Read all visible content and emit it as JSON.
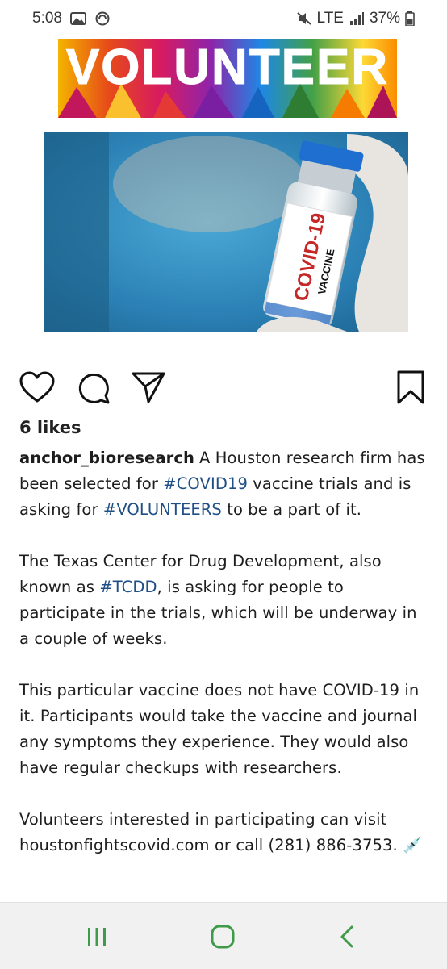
{
  "status_bar": {
    "time": "5:08",
    "network": "LTE",
    "battery": "37%",
    "icons": [
      "gallery-icon",
      "sync-icon",
      "mute-icon",
      "signal-icon",
      "battery-icon"
    ]
  },
  "post": {
    "banner_word": "VOLUNTEER",
    "vial_label_main": "COVID-19",
    "vial_label_sub": "VACCINE",
    "likes": "6 likes",
    "username": "anchor_bioresearch",
    "caption_line_1a": "A Houston research firm has been selected for",
    "hashtag_1": "#COVID19",
    "caption_line_1b": "vaccine trials and is asking for",
    "hashtag_2": "#VOLUNTEERS",
    "caption_line_1c": "to be a part of it.",
    "caption_2a": "The Texas Center for Drug Development, also known as",
    "hashtag_3": "#TCDD",
    "caption_2b": ", is asking for people to participate in the trials, which will be underway in a couple of weeks.",
    "caption_3": "This particular vaccine does not have COVID-19 in it. Participants would take the vaccine and journal any symptoms they experience. They would also have regular checkups with researchers.",
    "caption_4": "Volunteers interested in participating can visit houstonfightscovid.com or call (281) 886-3753. 💉"
  },
  "actions": {
    "icons": [
      "heart-icon",
      "comment-icon",
      "share-icon",
      "bookmark-icon"
    ]
  },
  "nav": {
    "icons": [
      "recent-apps-icon",
      "home-icon",
      "back-icon"
    ],
    "accent": "#3f9a4a"
  }
}
